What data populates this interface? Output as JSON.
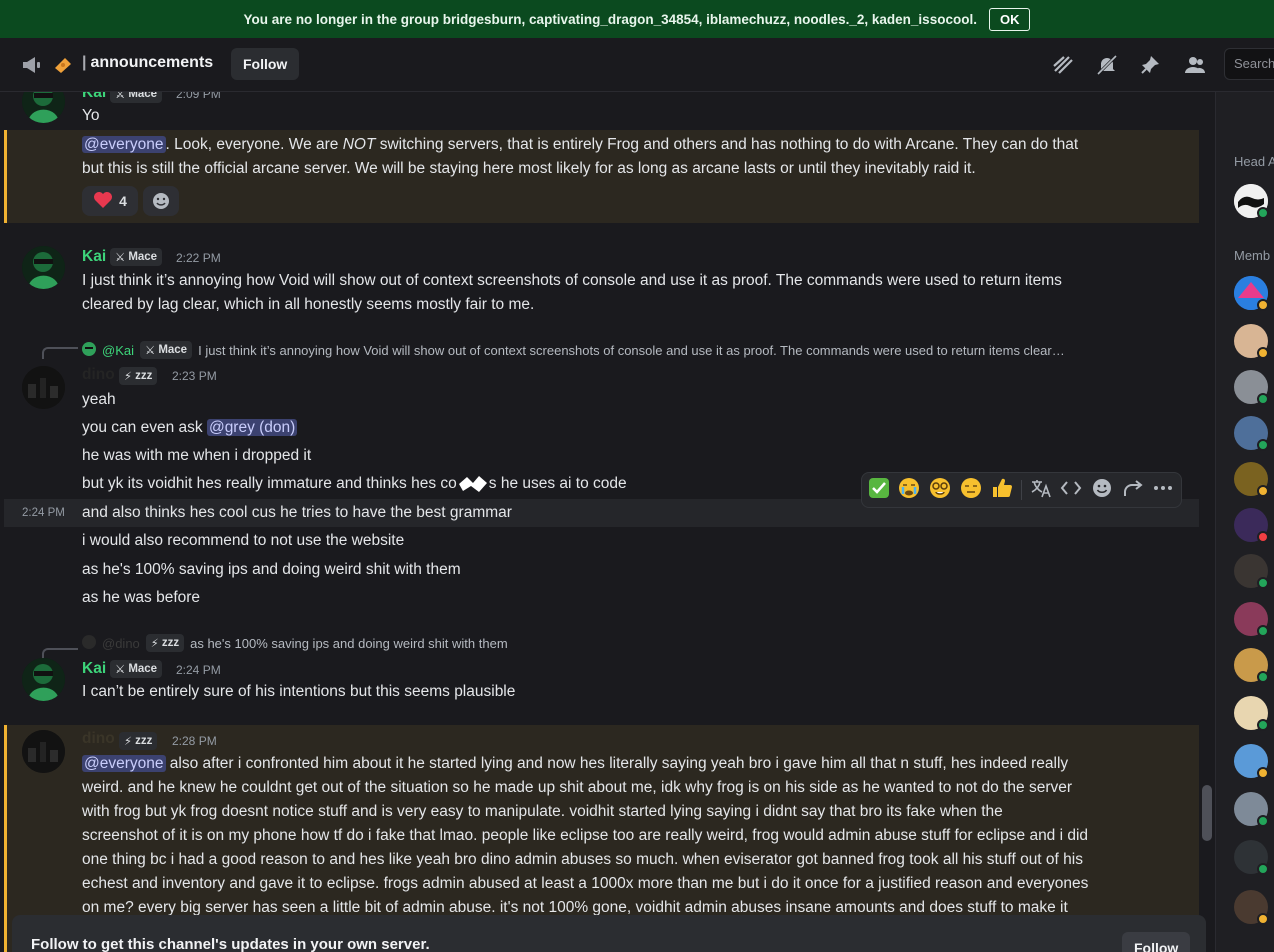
{
  "notice": {
    "text": "You are no longer in the group bridgesburn, captivating_dragon_34854, iblamechuzz, noodles._2, kaden_issocool.",
    "ok_label": "OK"
  },
  "header": {
    "channel_name": "announcements",
    "follow_label": "Follow",
    "search_placeholder": "Search"
  },
  "messages": {
    "m1": {
      "author": "Kai",
      "tag": "Mace",
      "time": "2:09 PM",
      "text": "Yo"
    },
    "m2": {
      "mention": "@everyone",
      "text_a": ". Look, everyone. We are ",
      "text_em": "NOT",
      "text_b": " switching servers, that is entirely Frog and others and has nothing to do with Arcane. They can do that",
      "line2": "but this is still the official arcane server. We will be staying here most likely for as long as arcane lasts or until they inevitably raid it.",
      "reaction_count": "4"
    },
    "m3": {
      "author": "Kai",
      "tag": "Mace",
      "time": "2:22 PM",
      "line1": "I just think it’s annoying how Void will show out of context screenshots of console and use it as proof. The commands were used to return items",
      "line2": "cleared by lag clear, which in all honestly seems mostly fair to me."
    },
    "m4": {
      "reply_author": "@Kai",
      "reply_tag": "Mace",
      "reply_text": "I just think it’s annoying how Void will show out of context screenshots of console and use it as proof. The commands were used to return items clear…",
      "author": "dino",
      "tag": "zzz",
      "time": "2:23 PM",
      "lines": [
        "yeah",
        "you can even ask ",
        "he was with me when i dropped it",
        "but yk its voidhit hes really immature and thinks hes co",
        "s he uses ai to code",
        "and also thinks hes cool cus he tries to have the best grammar",
        "i would also recommend to not use the website",
        "as he's 100% saving ips and doing weird shit with them",
        "as he was before"
      ],
      "mention_grey": "@grey (don)",
      "hover_time": "2:24 PM"
    },
    "m5": {
      "reply_author": "@dino",
      "reply_tag": "zzz",
      "reply_text": "as he's 100% saving ips and doing weird shit with them",
      "author": "Kai",
      "tag": "Mace",
      "time": "2:24 PM",
      "text": "I can’t be entirely sure of his intentions but this seems plausible"
    },
    "m6": {
      "author": "dino",
      "tag": "zzz",
      "time": "2:28 PM",
      "mention": "@everyone",
      "line1": " also after i confronted him about it he started lying and now hes literally saying yeah bro i gave him all that n stuff, hes indeed really",
      "lines": [
        "weird. and he knew he couldnt get out of the situation so he made up shit about me, idk why frog is on his side as he wanted to not do the server",
        "with frog but yk frog doesnt notice stuff and is very easy to manipulate. voidhit started lying saying i didnt say that bro its fake when the",
        "screenshot of it is on my phone how tf do i fake that lmao. people like eclipse too are really weird, frog would admin abuse stuff for eclipse and i did",
        "one thing bc i had a good reason to and hes like yeah bro dino admin abuses so much. when eviserator got banned frog took all his stuff out of his",
        "echest and inventory and gave it to eclipse. frogs admin abused at least a 1000x more than me but i do it once for a justified reason and everyones",
        "on me? every big server has seen a little bit of admin abuse. it's not 100% gone, voidhit admin abuses insane amounts and does stuff to make it"
      ]
    }
  },
  "follow_bar": {
    "text": "Follow to get this channel's updates in your own server.",
    "button": "Follow"
  },
  "members": {
    "group1": "Head A",
    "group2": "Memb"
  },
  "colors": {
    "kai_name": "#3dd47a",
    "mention_bg": "#3c4270",
    "highlight_edge": "#f0b232",
    "notice_bg": "#0b4a1f"
  }
}
